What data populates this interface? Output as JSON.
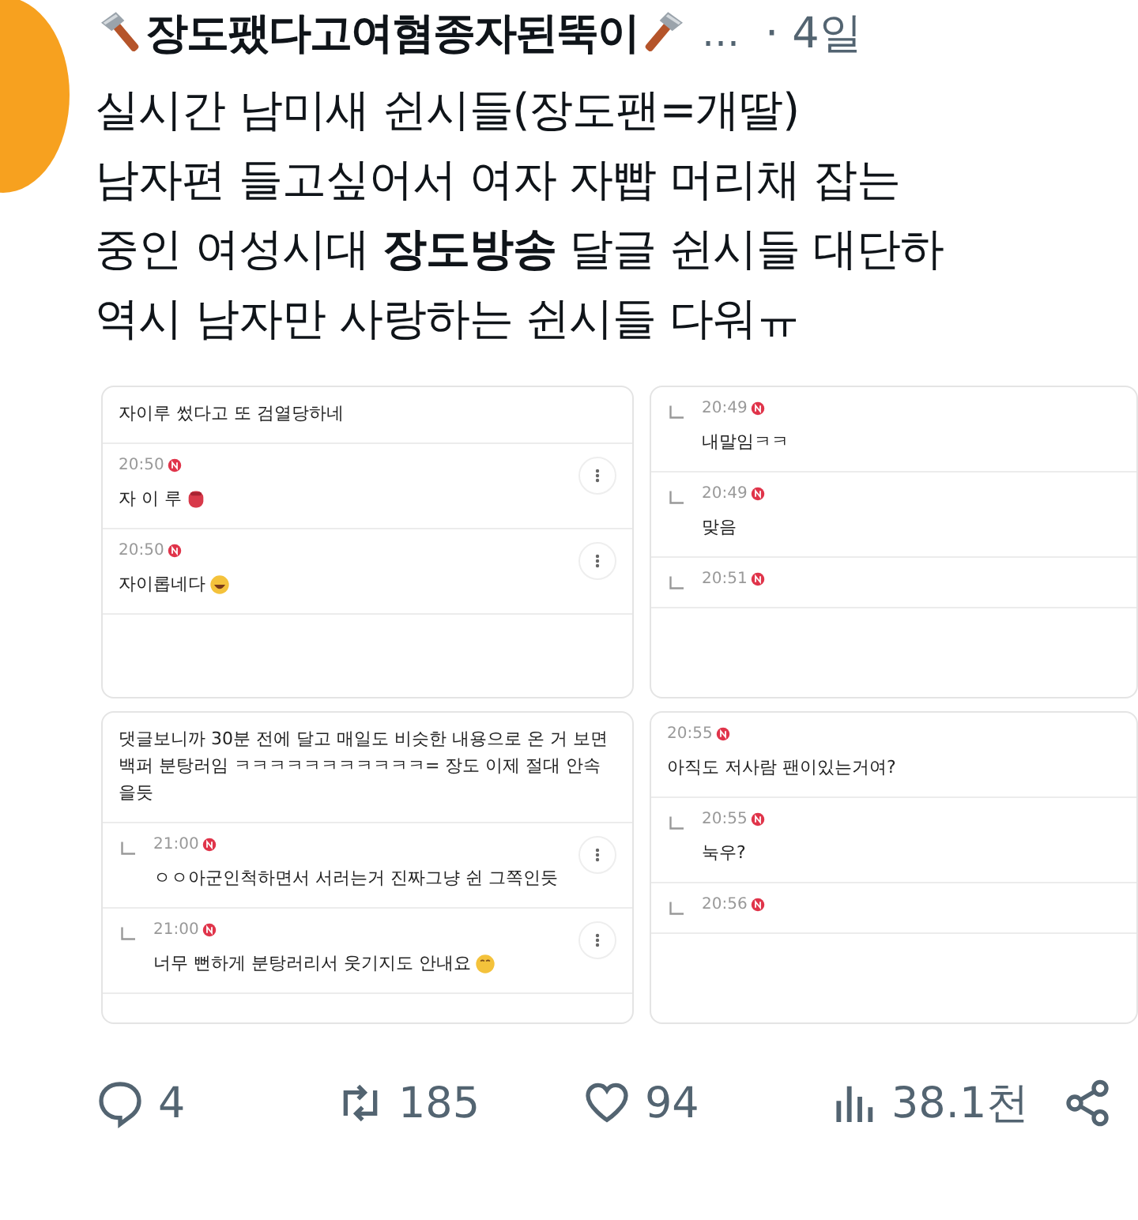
{
  "post": {
    "author": "장도팼다고여혐종자된뚝이",
    "overflow": "…",
    "time": "· 4일",
    "text": "실시간 남미새 쉰시들(장도팬=개딸)\n남자편 들고싶어서 여자 자빱 머리채 잡는\n중인 여성시대 **장도방송** 달글 쉰시들 대단하\n역시 남자만 사랑하는 쉰시들 다워ㅠ"
  },
  "panels": [
    {
      "items": [
        {
          "kind": "continuation",
          "text": "자이루 썼다고 또 검열당하네"
        },
        {
          "kind": "comment",
          "time": "20:50",
          "text": "자 이 루",
          "emoji": [
            {
              "kind": "tongue"
            }
          ],
          "menu": true
        },
        {
          "kind": "comment",
          "time": "20:50",
          "text": "자이롭네다",
          "emoji": [
            {
              "kind": "grin"
            }
          ],
          "menu": true
        }
      ]
    },
    {
      "items": [
        {
          "kind": "reply",
          "time": "20:49",
          "text": "내말임ㅋㅋ"
        },
        {
          "kind": "reply",
          "time": "20:49",
          "text": "맞음"
        },
        {
          "kind": "reply",
          "time": "20:51"
        }
      ]
    },
    {
      "items": [
        {
          "kind": "continuation",
          "text": "댓글보니까 30분 전에 달고 매일도 비슷한 내용으로 온 거 보면 백퍼 분탕러임 ㅋㅋㅋㅋㅋㅋㅋㅋㅋㅋㅋ= 장도 이제 절대 안속을듯"
        },
        {
          "kind": "reply",
          "time": "21:00",
          "text": "ㅇㅇ아군인척하면서 서러는거 진짜그냥 쉰 그쪽인듯",
          "menu": true
        },
        {
          "kind": "reply",
          "time": "21:00",
          "text": "너무 뻔하게 분탕러리서 웃기지도 안내요",
          "emoji": [
            {
              "kind": "smile"
            }
          ],
          "menu": true
        }
      ]
    },
    {
      "items": [
        {
          "kind": "comment",
          "time": "20:55",
          "text": "아직도 저사람 팬이있는거여?"
        },
        {
          "kind": "reply",
          "time": "20:55",
          "text": "눅우?"
        },
        {
          "kind": "reply",
          "time": "20:56"
        }
      ]
    }
  ],
  "actions": [
    {
      "kind": "reply",
      "count": "4"
    },
    {
      "kind": "repost",
      "count": "185"
    },
    {
      "kind": "like",
      "count": "94"
    },
    {
      "kind": "views",
      "count": "38.1천"
    },
    {
      "kind": "share"
    }
  ]
}
